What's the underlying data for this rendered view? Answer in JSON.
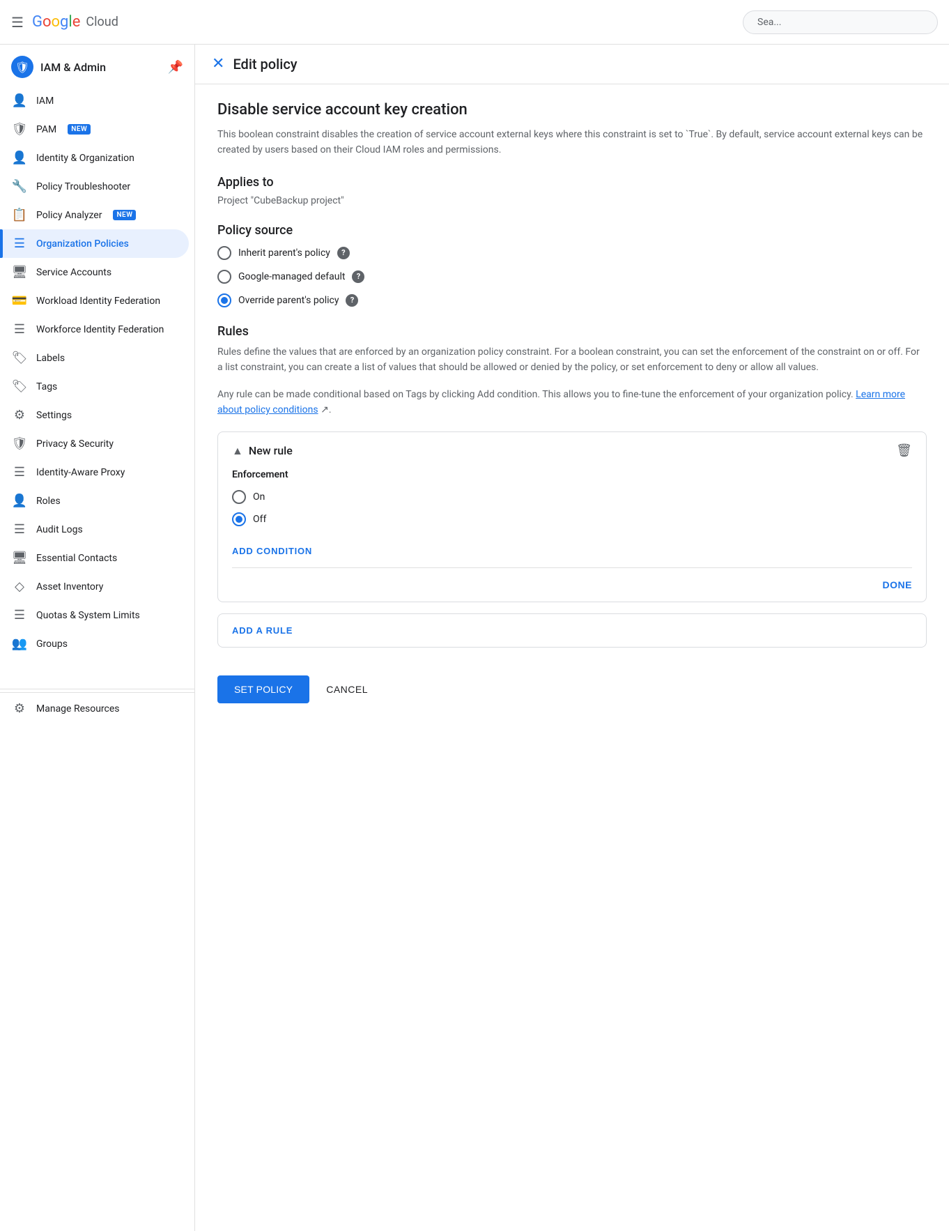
{
  "topbar": {
    "menu_icon": "☰",
    "logo_letters": [
      "G",
      "o",
      "o",
      "g",
      "l",
      "e"
    ],
    "logo_text": "Google",
    "cloud_text": "Cloud",
    "search_placeholder": "Sea..."
  },
  "sidebar": {
    "header": {
      "title": "IAM & Admin",
      "pin_icon": "📌"
    },
    "items": [
      {
        "id": "iam",
        "label": "IAM",
        "icon": "👤",
        "active": false,
        "badge": null
      },
      {
        "id": "pam",
        "label": "PAM",
        "icon": "🛡",
        "active": false,
        "badge": "NEW"
      },
      {
        "id": "identity-org",
        "label": "Identity & Organization",
        "icon": "👤",
        "active": false,
        "badge": null
      },
      {
        "id": "policy-troubleshooter",
        "label": "Policy Troubleshooter",
        "icon": "🔧",
        "active": false,
        "badge": null
      },
      {
        "id": "policy-analyzer",
        "label": "Policy Analyzer",
        "icon": "📋",
        "active": false,
        "badge": "NEW"
      },
      {
        "id": "org-policies",
        "label": "Organization Policies",
        "icon": "☰",
        "active": true,
        "badge": null
      },
      {
        "id": "service-accounts",
        "label": "Service Accounts",
        "icon": "🖥",
        "active": false,
        "badge": null
      },
      {
        "id": "workload-identity",
        "label": "Workload Identity Federation",
        "icon": "💳",
        "active": false,
        "badge": null
      },
      {
        "id": "workforce-identity",
        "label": "Workforce Identity Federation",
        "icon": "☰",
        "active": false,
        "badge": null
      },
      {
        "id": "labels",
        "label": "Labels",
        "icon": "🏷",
        "active": false,
        "badge": null
      },
      {
        "id": "tags",
        "label": "Tags",
        "icon": "🏷",
        "active": false,
        "badge": null
      },
      {
        "id": "settings",
        "label": "Settings",
        "icon": "⚙",
        "active": false,
        "badge": null
      },
      {
        "id": "privacy-security",
        "label": "Privacy & Security",
        "icon": "🛡",
        "active": false,
        "badge": null
      },
      {
        "id": "iap",
        "label": "Identity-Aware Proxy",
        "icon": "☰",
        "active": false,
        "badge": null
      },
      {
        "id": "roles",
        "label": "Roles",
        "icon": "👤",
        "active": false,
        "badge": null
      },
      {
        "id": "audit-logs",
        "label": "Audit Logs",
        "icon": "☰",
        "active": false,
        "badge": null
      },
      {
        "id": "essential-contacts",
        "label": "Essential Contacts",
        "icon": "🖥",
        "active": false,
        "badge": null
      },
      {
        "id": "asset-inventory",
        "label": "Asset Inventory",
        "icon": "◇",
        "active": false,
        "badge": null
      },
      {
        "id": "quotas",
        "label": "Quotas & System Limits",
        "icon": "☰",
        "active": false,
        "badge": null
      },
      {
        "id": "groups",
        "label": "Groups",
        "icon": "👥",
        "active": false,
        "badge": null
      }
    ],
    "footer": {
      "icon": "⚙",
      "label": "Manage Resources"
    }
  },
  "edit_policy": {
    "header": {
      "close_icon": "✕",
      "title": "Edit policy"
    },
    "constraint": {
      "title": "Disable service account key creation",
      "description": "This boolean constraint disables the creation of service account external keys where this constraint is set to `True`. By default, service account external keys can be created by users based on their Cloud IAM roles and permissions."
    },
    "applies_to": {
      "label": "Applies to",
      "value": "Project \"CubeBackup project\""
    },
    "policy_source": {
      "label": "Policy source",
      "options": [
        {
          "id": "inherit",
          "label": "Inherit parent's policy",
          "selected": false
        },
        {
          "id": "google-managed",
          "label": "Google-managed default",
          "selected": false
        },
        {
          "id": "override",
          "label": "Override parent's policy",
          "selected": true
        }
      ]
    },
    "rules": {
      "label": "Rules",
      "description": "Rules define the values that are enforced by an organization policy constraint. For a boolean constraint, you can set the enforcement of the constraint on or off. For a list constraint, you can create a list of values that should be allowed or denied by the policy, or set enforcement to deny or allow all values.",
      "conditions_text": "Any rule can be made conditional based on Tags by clicking Add condition. This allows you to fine-tune the enforcement of your organization policy.",
      "learn_link_text": "Learn more about policy conditions",
      "new_rule": {
        "title": "New rule",
        "enforcement_label": "Enforcement",
        "enforcement_options": [
          {
            "id": "on",
            "label": "On",
            "selected": false
          },
          {
            "id": "off",
            "label": "Off",
            "selected": true
          }
        ],
        "add_condition_label": "ADD CONDITION",
        "done_label": "DONE"
      },
      "add_rule_label": "ADD A RULE"
    },
    "actions": {
      "set_policy_label": "SET POLICY",
      "cancel_label": "CANCEL"
    }
  }
}
